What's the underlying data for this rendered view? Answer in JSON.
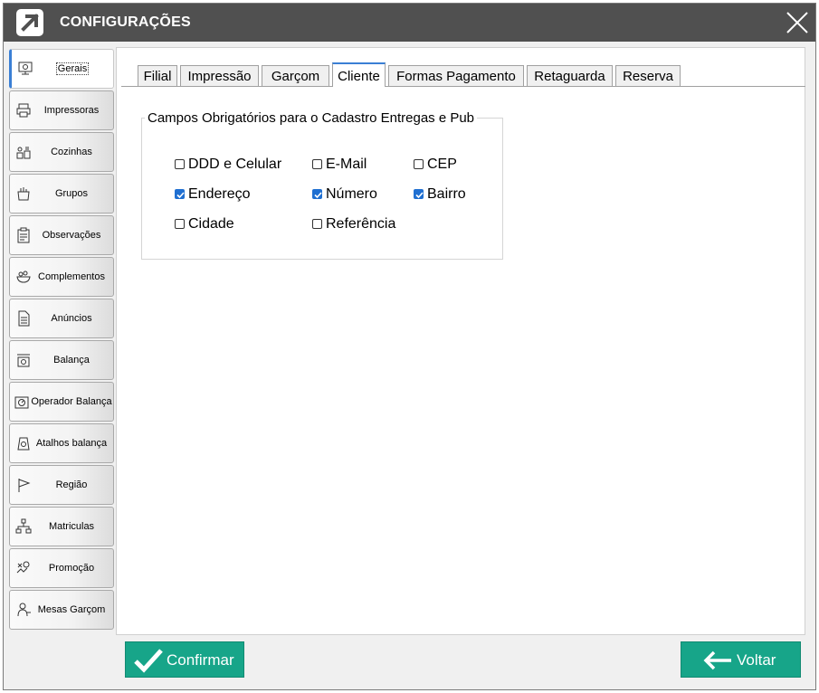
{
  "window": {
    "title": "CONFIGURAÇÕES"
  },
  "sidebar": {
    "items": [
      {
        "label": "Gerais",
        "icon": "monitor-gear-icon",
        "active": true
      },
      {
        "label": "Impressoras",
        "icon": "printer-icon"
      },
      {
        "label": "Cozinhas",
        "icon": "kitchen-icon"
      },
      {
        "label": "Grupos",
        "icon": "grocery-bag-icon"
      },
      {
        "label": "Observações",
        "icon": "clipboard-icon"
      },
      {
        "label": "Complementos",
        "icon": "salad-bowl-icon"
      },
      {
        "label": "Anúncios",
        "icon": "document-icon"
      },
      {
        "label": "Balança",
        "icon": "scale-icon"
      },
      {
        "label": "Operador  Balança",
        "icon": "scale-dial-icon"
      },
      {
        "label": "Atalhos balança",
        "icon": "scale-icon"
      },
      {
        "label": "Região",
        "icon": "flag-icon"
      },
      {
        "label": "Matriculas",
        "icon": "network-icon"
      },
      {
        "label": "Promoção",
        "icon": "promotion-icon"
      },
      {
        "label": "Mesas Garçom",
        "icon": "waiter-icon"
      }
    ]
  },
  "tabs": [
    {
      "label": "Filial"
    },
    {
      "label": "Impressão"
    },
    {
      "label": "Garçom"
    },
    {
      "label": "Cliente",
      "active": true
    },
    {
      "label": "Formas Pagamento"
    },
    {
      "label": "Retaguarda"
    },
    {
      "label": "Reserva"
    }
  ],
  "group": {
    "title": "Campos Obrigatórios para o Cadastro Entregas e Pub",
    "fields": [
      {
        "label": "DDD e Celular",
        "checked": false
      },
      {
        "label": "E-Mail",
        "checked": false
      },
      {
        "label": "CEP",
        "checked": false
      },
      {
        "label": "Endereço",
        "checked": true
      },
      {
        "label": "Número",
        "checked": true
      },
      {
        "label": "Bairro",
        "checked": true
      },
      {
        "label": "Cidade",
        "checked": false
      },
      {
        "label": "Referência",
        "checked": false
      }
    ]
  },
  "buttons": {
    "confirm": "Confirmar",
    "back": "Voltar"
  },
  "colors": {
    "titlebar": "#505050",
    "accent": "#17a589",
    "checkbox": "#1f6fd1",
    "tab_active": "#3a7fd5"
  }
}
